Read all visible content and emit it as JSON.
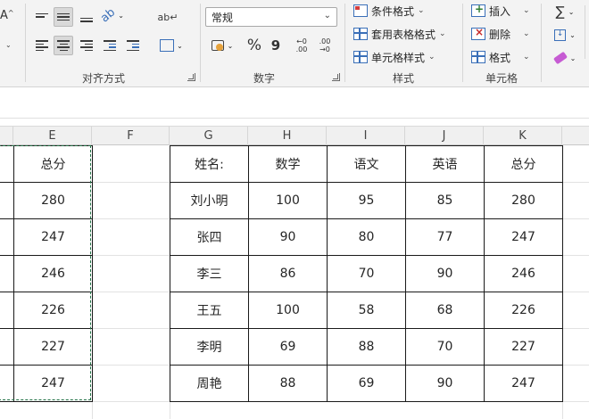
{
  "ribbon": {
    "font_partial": "A",
    "wrap_icon": "ab↵",
    "groups": {
      "alignment": "对齐方式",
      "number": "数字",
      "styles": "样式",
      "cells": "单元格"
    },
    "number_format_value": "常规",
    "percent_symbol": "%",
    "comma_symbol": "9",
    "styles_commands": [
      "条件格式",
      "套用表格格式",
      "单元格样式"
    ],
    "cells_commands": [
      "插入",
      "删除",
      "格式"
    ],
    "editing_sigma": "∑"
  },
  "columns": [
    "E",
    "F",
    "G",
    "H",
    "I",
    "J",
    "K"
  ],
  "left_block": {
    "header": "总分",
    "values": [
      "280",
      "247",
      "246",
      "226",
      "227",
      "247"
    ]
  },
  "score_table": {
    "headers": [
      "姓名:",
      "数学",
      "语文",
      "英语",
      "总分"
    ],
    "rows": [
      [
        "刘小明",
        "100",
        "95",
        "85",
        "280"
      ],
      [
        "张四",
        "90",
        "80",
        "77",
        "247"
      ],
      [
        "李三",
        "86",
        "70",
        "90",
        "246"
      ],
      [
        "王五",
        "100",
        "58",
        "68",
        "226"
      ],
      [
        "李明",
        "69",
        "88",
        "70",
        "227"
      ],
      [
        "周艳",
        "88",
        "69",
        "90",
        "247"
      ]
    ]
  },
  "colors": {
    "marquee": "#217346",
    "border": "#1a1a1a",
    "ribbon_bg": "#f3f3f3"
  }
}
